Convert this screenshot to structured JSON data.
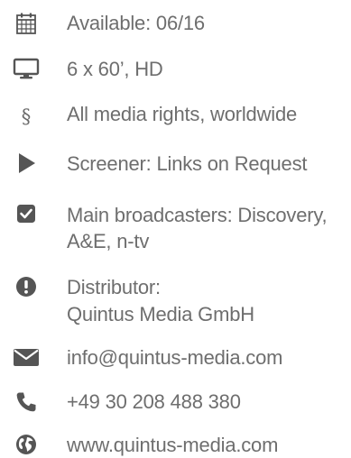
{
  "items": [
    {
      "icon": "calendar-icon",
      "lines": [
        "Available: 06/16"
      ]
    },
    {
      "icon": "monitor-icon",
      "lines": [
        "6 x 60’, HD"
      ]
    },
    {
      "icon": "section-sign-icon",
      "glyph": "§",
      "lines": [
        "All media rights, worldwide"
      ]
    },
    {
      "icon": "play-icon",
      "lines": [
        "Screener: Links on Request"
      ]
    },
    {
      "icon": "checkbox-icon",
      "lines": [
        "Main broadcasters: Discovery,",
        "A&E, n-tv"
      ]
    },
    {
      "icon": "exclamation-circle-icon",
      "lines": [
        "Distributor:",
        "Quintus Media GmbH"
      ]
    },
    {
      "icon": "envelope-icon",
      "lines": [
        "info@quintus-media.com"
      ]
    },
    {
      "icon": "phone-icon",
      "lines": [
        "+49 30 208 488 380"
      ]
    },
    {
      "icon": "globe-icon",
      "lines": [
        "www.quintus-media.com"
      ]
    }
  ],
  "colors": {
    "text": "#6e6e6e",
    "icon": "#555555"
  }
}
